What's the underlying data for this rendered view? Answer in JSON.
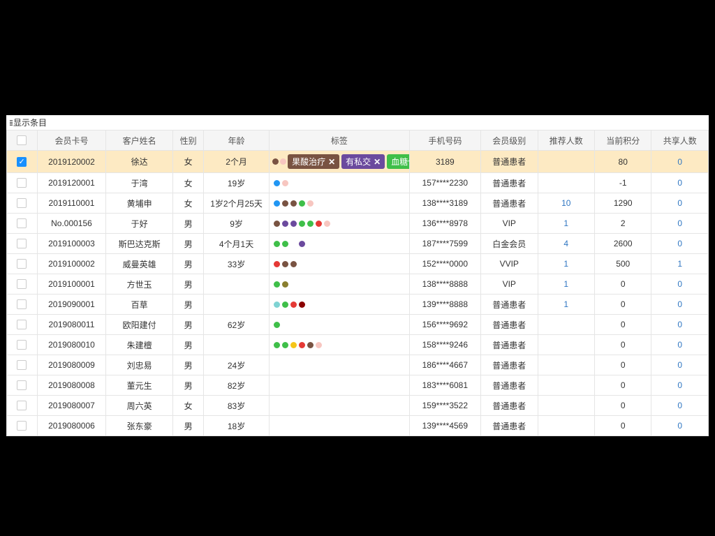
{
  "toolbar": {
    "display_label": "显示条目"
  },
  "headers": {
    "card": "会员卡号",
    "name": "客户姓名",
    "sex": "性别",
    "age": "年龄",
    "tags": "标签",
    "phone": "手机号码",
    "level": "会员级别",
    "refcount": "推荐人数",
    "points": "当前积分",
    "share": "共享人数"
  },
  "tag_chips": [
    {
      "label": "果酸治疗",
      "bg": "#795342"
    },
    {
      "label": "有私交",
      "bg": "#6b4a9e"
    },
    {
      "label": "血糖偏高",
      "bg": "#3fbf49"
    }
  ],
  "rows": [
    {
      "selected": true,
      "card": "2019120002",
      "name": "徐达",
      "sex": "女",
      "age": "2个月",
      "pretag_dots": [
        "#795342",
        "#f7c6c0"
      ],
      "phone_tail": "3189",
      "level": "普通患者",
      "ref": "",
      "points": "80",
      "share": "0"
    },
    {
      "card": "2019120001",
      "name": "于湾",
      "sex": "女",
      "age": "19岁",
      "dots": [
        "#2196f3",
        "#f7c6c0"
      ],
      "phone": "157****2230",
      "level": "普通患者",
      "ref": "",
      "points": "-1",
      "share": "0"
    },
    {
      "card": "2019110001",
      "name": "黄埔申",
      "sex": "女",
      "age": "1岁2个月25天",
      "dots": [
        "#2196f3",
        "#795342",
        "#795342",
        "#3fbf49",
        "#f7c6c0"
      ],
      "phone": "138****3189",
      "level": "普通患者",
      "ref": "10",
      "points": "1290",
      "share": "0"
    },
    {
      "card": "No.000156",
      "name": "于好",
      "sex": "男",
      "age": "9岁",
      "dots": [
        "#795342",
        "#6b4a9e",
        "#6b4a9e",
        "#3fbf49",
        "#3fbf49",
        "#e53935",
        "#f7c6c0"
      ],
      "phone": "136****8978",
      "level": "VIP",
      "ref": "1",
      "points": "2",
      "share": "0"
    },
    {
      "card": "2019100003",
      "name": "斯巴达克斯",
      "sex": "男",
      "age": "4个月1天",
      "dots": [
        "#3fbf49",
        "#3fbf49",
        "#ffffff00",
        "#6b4a9e"
      ],
      "phone": "187****7599",
      "level": "白金会员",
      "ref": "4",
      "points": "2600",
      "share": "0"
    },
    {
      "card": "2019100002",
      "name": "威曼英雄",
      "sex": "男",
      "age": "33岁",
      "dots": [
        "#e53935",
        "#795342",
        "#795342"
      ],
      "phone": "152****0000",
      "level": "VVIP",
      "ref": "1",
      "points": "500",
      "share": "1"
    },
    {
      "card": "2019100001",
      "name": "方世玉",
      "sex": "男",
      "age": "",
      "dots": [
        "#3fbf49",
        "#8a7f2f"
      ],
      "phone": "138****8888",
      "level": "VIP",
      "ref": "1",
      "points": "0",
      "share": "0"
    },
    {
      "card": "2019090001",
      "name": "百草",
      "sex": "男",
      "age": "",
      "dots": [
        "#7fd3d3",
        "#3fbf49",
        "#e53935",
        "#8b0000"
      ],
      "phone": "139****8888",
      "level": "普通患者",
      "ref": "1",
      "points": "0",
      "share": "0"
    },
    {
      "card": "2019080011",
      "name": "欧阳建付",
      "sex": "男",
      "age": "62岁",
      "dots": [
        "#3fbf49"
      ],
      "phone": "156****9692",
      "level": "普通患者",
      "ref": "",
      "points": "0",
      "share": "0"
    },
    {
      "card": "2019080010",
      "name": "朱建檀",
      "sex": "男",
      "age": "",
      "dots": [
        "#3fbf49",
        "#3fbf49",
        "#f5c518",
        "#e53935",
        "#795342",
        "#f7c6c0"
      ],
      "phone": "158****9246",
      "level": "普通患者",
      "ref": "",
      "points": "0",
      "share": "0"
    },
    {
      "card": "2019080009",
      "name": "刘忠易",
      "sex": "男",
      "age": "24岁",
      "dots": [],
      "phone": "186****4667",
      "level": "普通患者",
      "ref": "",
      "points": "0",
      "share": "0"
    },
    {
      "card": "2019080008",
      "name": "董元生",
      "sex": "男",
      "age": "82岁",
      "dots": [],
      "phone": "183****6081",
      "level": "普通患者",
      "ref": "",
      "points": "0",
      "share": "0"
    },
    {
      "card": "2019080007",
      "name": "周六英",
      "sex": "女",
      "age": "83岁",
      "dots": [],
      "phone": "159****3522",
      "level": "普通患者",
      "ref": "",
      "points": "0",
      "share": "0"
    },
    {
      "card": "2019080006",
      "name": "张东豪",
      "sex": "男",
      "age": "18岁",
      "dots": [],
      "phone": "139****4569",
      "level": "普通患者",
      "ref": "",
      "points": "0",
      "share": "0"
    }
  ]
}
